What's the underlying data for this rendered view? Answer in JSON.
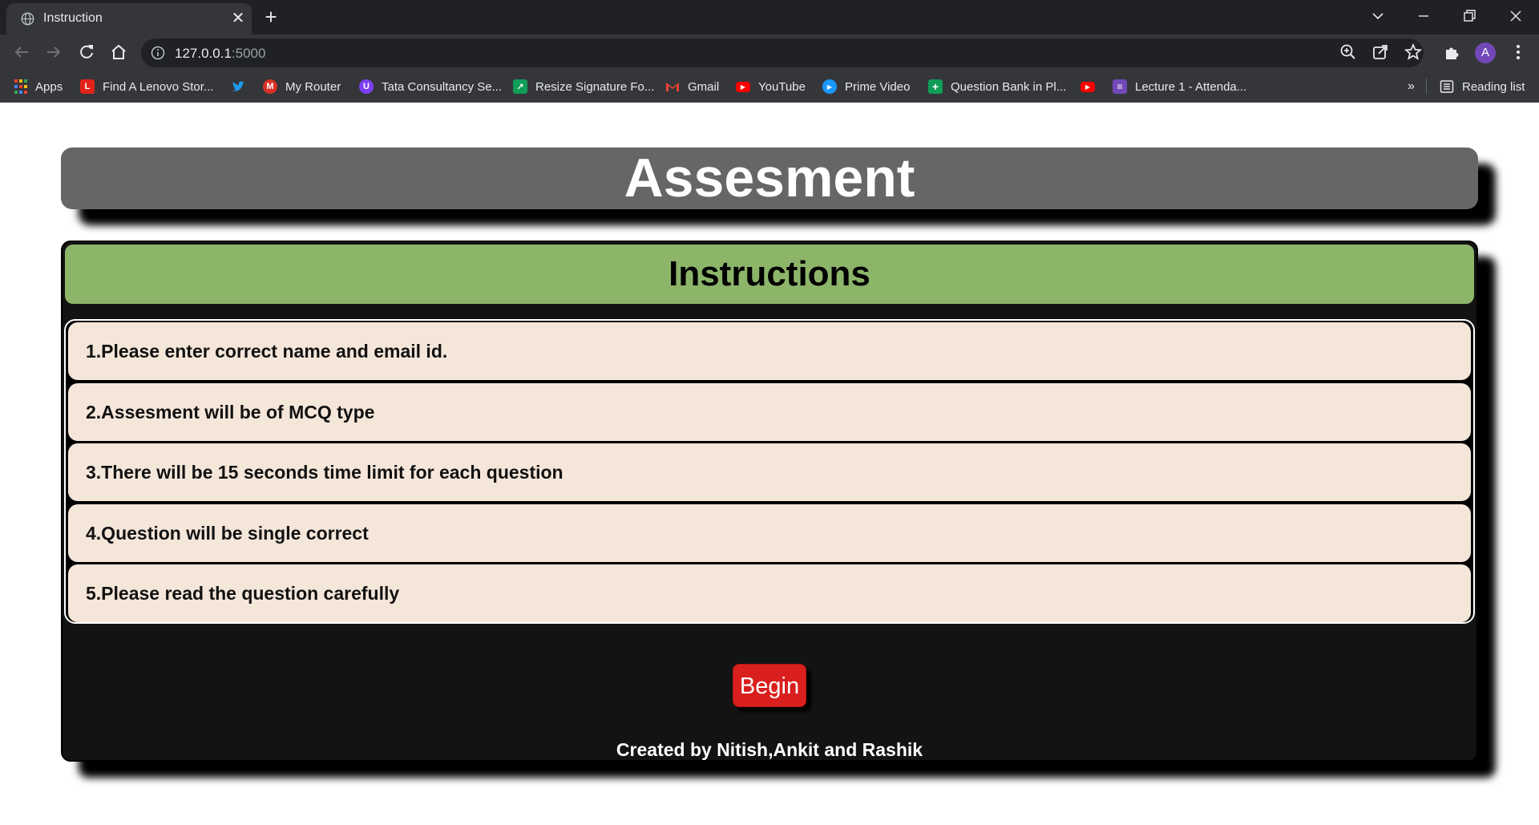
{
  "browser": {
    "tab_title": "Instruction",
    "url_host": "127.0.0.1",
    "url_port": ":5000",
    "bookmarks": [
      {
        "label": "Apps",
        "icon": "apps-grid-icon",
        "color": "#e8453c"
      },
      {
        "label": "Find A Lenovo Stor...",
        "icon": "lenovo-icon",
        "color": "#e2231a"
      },
      {
        "label": "",
        "icon": "twitter-icon",
        "color": "#1d9bf0"
      },
      {
        "label": "My Router",
        "icon": "router-icon",
        "color": "#d93025"
      },
      {
        "label": "Tata Consultancy Se...",
        "icon": "tcs-icon",
        "color": "#7e3ff2"
      },
      {
        "label": "Resize Signature Fo...",
        "icon": "resize-icon",
        "color": "#0f9d58"
      },
      {
        "label": "Gmail",
        "icon": "gmail-icon",
        "color": "#ea4335"
      },
      {
        "label": "YouTube",
        "icon": "youtube-icon",
        "color": "#ff0000"
      },
      {
        "label": "Prime Video",
        "icon": "prime-video-icon",
        "color": "#1a98ff"
      },
      {
        "label": "Question Bank in Pl...",
        "icon": "sheets-icon",
        "color": "#0f9d58"
      },
      {
        "label": "",
        "icon": "youtube-icon",
        "color": "#ff0000"
      },
      {
        "label": "Lecture 1 - Attenda...",
        "icon": "forms-icon",
        "color": "#7248b9"
      }
    ],
    "overflow_label": "»",
    "reading_list_label": "Reading list",
    "profile_initial": "A"
  },
  "page": {
    "header_title": "Assesment",
    "instructions_title": "Instructions",
    "instructions": [
      "1.Please enter correct name and email id.",
      "2.Assesment will be of MCQ type",
      "3.There will be 15 seconds time limit for each question",
      "4.Question will be single correct",
      "5.Please read the question carefully"
    ],
    "begin_label": "Begin",
    "footer": "Created by Nitish,Ankit and Rashik"
  },
  "colors": {
    "header_bg": "#666666",
    "instructions_head_bg": "#8db56a",
    "item_bg": "#f5e6da",
    "card_bg": "#131313",
    "begin_bg": "#d9201f"
  }
}
